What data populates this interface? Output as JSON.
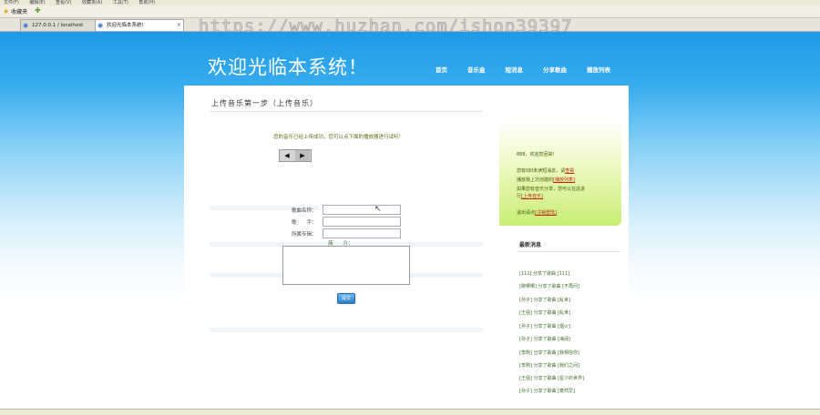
{
  "browser": {
    "menu": [
      "文件(F)",
      "编辑(E)",
      "查看(V)",
      "收藏夹(A)",
      "工具(T)",
      "帮助(H)"
    ],
    "favorites_label": "收藏夹",
    "tabs": [
      {
        "label": "127.0.0.1 / localhost"
      },
      {
        "label": "欢迎光临本系统!"
      }
    ],
    "watermark": "https://www.huzhan.com/ishop39397"
  },
  "site": {
    "title": "欢迎光临本系统！",
    "nav": [
      "首页",
      "音乐盒",
      "短消息",
      "分享歌曲",
      "播放列表"
    ]
  },
  "main": {
    "heading": "上传音乐第一步（上传音乐）",
    "success_msg": "您的音乐已经上传成功，您可以点下面的播放器进行试听！",
    "form": {
      "song_label": "歌曲名称：",
      "singer_label": "歌　　手：",
      "album_label": "所属专辑：",
      "intro_label": "简　　介：",
      "submit_label": "提交"
    }
  },
  "sidebar": {
    "welcome": "888，欢迎您回来！",
    "lines": [
      {
        "text": "您有0封未读短消息，请",
        "link": "查看"
      },
      {
        "text": "播放我上次创建的",
        "link": "[播放列表]"
      },
      {
        "text": "如果您有音乐分享，您可以在这进",
        "link": ""
      },
      {
        "text": "行",
        "link": "[上传音乐]"
      },
      {
        "text": "退出请点",
        "link": "[注销登陆]"
      }
    ]
  },
  "news": {
    "title": "最新消息",
    "items": [
      "[111] 分享了歌曲 [111]",
      "[碗哪哪] 分享了歌曲 [不再问]",
      "[孙子] 分享了歌曲 [乱世]",
      "[王强] 分享了歌曲 [乱世]",
      "[孙子] 分享了歌曲 [烟火]",
      "[孙子] 分享了歌曲 [海阔]",
      "[李刚] 分享了歌曲 [我相信你]",
      "[李刚] 分享了歌曲 [我们之间]",
      "[王强] 分享了歌曲 [星少的世界]",
      "[孙子] 分享了歌曲 [泰然早]"
    ]
  }
}
